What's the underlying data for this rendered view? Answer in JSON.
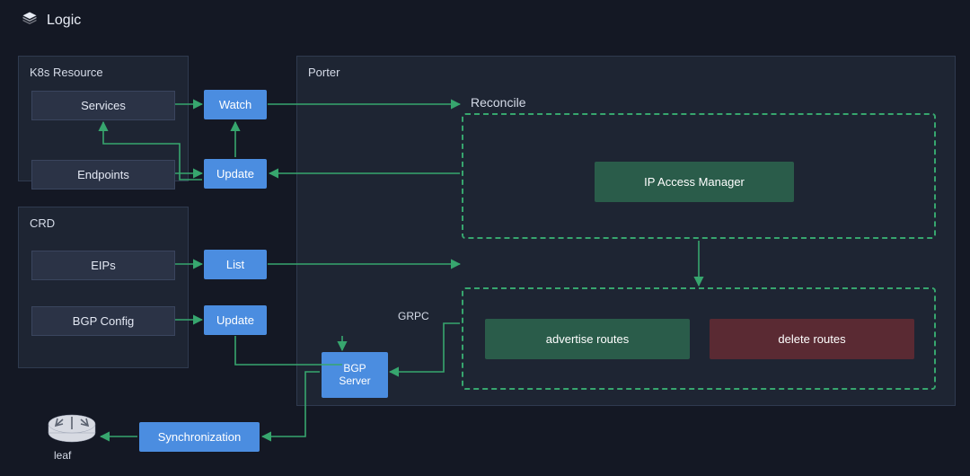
{
  "header": {
    "title": "Logic"
  },
  "k8s": {
    "panel_title": "K8s Resource",
    "services": "Services",
    "endpoints": "Endpoints"
  },
  "crd": {
    "panel_title": "CRD",
    "eips": "EIPs",
    "bgp_config": "BGP Config"
  },
  "actions": {
    "watch": "Watch",
    "update1": "Update",
    "list": "List",
    "update2": "Update",
    "sync": "Synchronization"
  },
  "porter": {
    "panel_title": "Porter",
    "reconcile": "Reconcile",
    "ip_access_manager": "IP Access Manager",
    "advertise_routes": "advertise routes",
    "delete_routes": "delete routes",
    "bgp_server": "BGP Server",
    "grpc": "GRPC"
  },
  "leaf": {
    "label": "leaf"
  },
  "colors": {
    "bg": "#141824",
    "panel": "#1e2533",
    "box": "#2b3346",
    "blue": "#4b8de0",
    "green": "#2a5c4a",
    "red": "#5a2a33",
    "arrow": "#37a66e"
  }
}
